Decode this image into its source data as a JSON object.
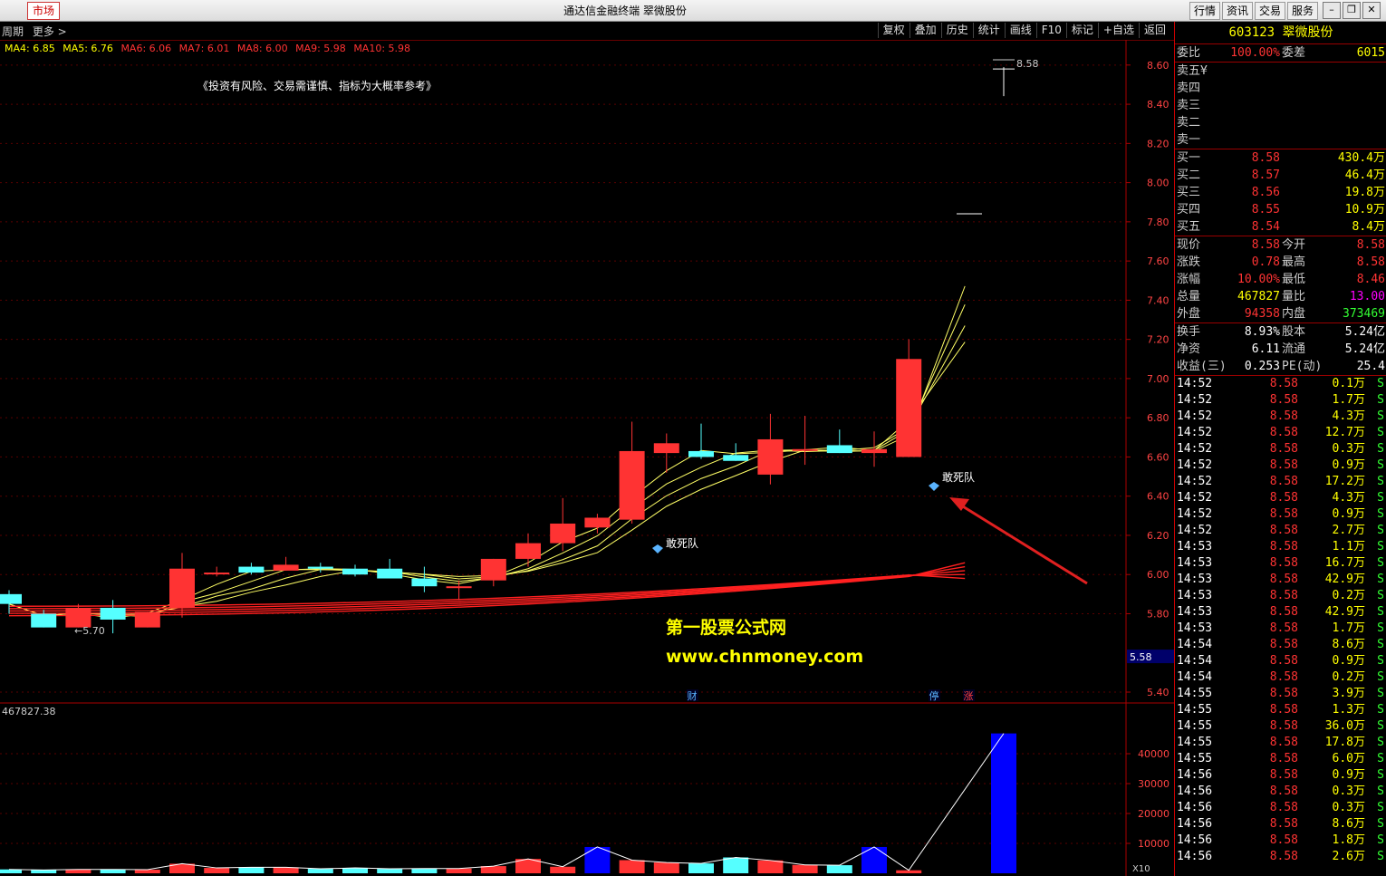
{
  "titlebar": {
    "market_tab": "市场",
    "title": "通达信金融终端  翠微股份",
    "menu": [
      "行情",
      "资讯",
      "交易",
      "服务"
    ]
  },
  "toolbar": {
    "left": [
      "周期",
      "更多 >"
    ],
    "right": [
      "复权",
      "叠加",
      "历史",
      "统计",
      "画线",
      "F10",
      "标记",
      "+自选",
      "返回"
    ]
  },
  "ma_legend": [
    {
      "label": "MA4: 6.85",
      "color": "#ffff00"
    },
    {
      "label": "MA5: 6.76",
      "color": "#ffff00"
    },
    {
      "label": "MA6: 6.06",
      "color": "#ff3333"
    },
    {
      "label": "MA7: 6.01",
      "color": "#ff3333"
    },
    {
      "label": "MA8: 6.00",
      "color": "#ff3333"
    },
    {
      "label": "MA9: 5.98",
      "color": "#ff3333"
    },
    {
      "label": "MA10: 5.98",
      "color": "#ff3333"
    }
  ],
  "warning_text": "《投资有风险、交易需谨慎、指标为大概率参考》",
  "chart_data": {
    "type": "candlestick",
    "ylim": [
      5.4,
      8.65
    ],
    "y_ticks": [
      "8.60",
      "8.40",
      "8.20",
      "8.00",
      "7.80",
      "7.60",
      "7.40",
      "7.20",
      "7.00",
      "6.80",
      "6.60",
      "6.40",
      "6.20",
      "6.00",
      "5.80",
      "5.40"
    ],
    "current_price_label": "5.58",
    "candles": [
      {
        "o": 5.9,
        "h": 5.92,
        "l": 5.8,
        "c": 5.85,
        "up": false
      },
      {
        "o": 5.8,
        "h": 5.82,
        "l": 5.73,
        "c": 5.73,
        "up": false
      },
      {
        "o": 5.73,
        "h": 5.85,
        "l": 5.73,
        "c": 5.83,
        "up": true
      },
      {
        "o": 5.83,
        "h": 5.87,
        "l": 5.7,
        "c": 5.77,
        "up": false
      },
      {
        "o": 5.73,
        "h": 5.81,
        "l": 5.73,
        "c": 5.81,
        "up": true
      },
      {
        "o": 5.83,
        "h": 6.11,
        "l": 5.78,
        "c": 6.03,
        "up": true
      },
      {
        "o": 6.01,
        "h": 6.04,
        "l": 5.99,
        "c": 6.01,
        "up": true
      },
      {
        "o": 6.04,
        "h": 6.06,
        "l": 6.0,
        "c": 6.01,
        "up": false
      },
      {
        "o": 6.02,
        "h": 6.09,
        "l": 6.02,
        "c": 6.05,
        "up": true
      },
      {
        "o": 6.04,
        "h": 6.06,
        "l": 6.01,
        "c": 6.03,
        "up": false
      },
      {
        "o": 6.03,
        "h": 6.05,
        "l": 5.99,
        "c": 6.0,
        "up": false
      },
      {
        "o": 6.03,
        "h": 6.08,
        "l": 5.99,
        "c": 5.98,
        "up": false
      },
      {
        "o": 5.98,
        "h": 6.04,
        "l": 5.91,
        "c": 5.94,
        "up": false
      },
      {
        "o": 5.94,
        "h": 5.97,
        "l": 5.87,
        "c": 5.94,
        "up": true
      },
      {
        "o": 5.97,
        "h": 6.08,
        "l": 5.94,
        "c": 6.08,
        "up": true
      },
      {
        "o": 6.08,
        "h": 6.21,
        "l": 6.04,
        "c": 6.16,
        "up": true
      },
      {
        "o": 6.16,
        "h": 6.39,
        "l": 6.12,
        "c": 6.26,
        "up": true
      },
      {
        "o": 6.24,
        "h": 6.31,
        "l": 6.21,
        "c": 6.29,
        "up": true
      },
      {
        "o": 6.28,
        "h": 6.78,
        "l": 6.26,
        "c": 6.63,
        "up": true
      },
      {
        "o": 6.62,
        "h": 6.72,
        "l": 6.52,
        "c": 6.67,
        "up": true
      },
      {
        "o": 6.63,
        "h": 6.77,
        "l": 6.59,
        "c": 6.6,
        "up": false
      },
      {
        "o": 6.61,
        "h": 6.67,
        "l": 6.58,
        "c": 6.58,
        "up": false
      },
      {
        "o": 6.51,
        "h": 6.82,
        "l": 6.46,
        "c": 6.69,
        "up": true
      },
      {
        "o": 6.64,
        "h": 6.81,
        "l": 6.56,
        "c": 6.64,
        "up": true
      },
      {
        "o": 6.66,
        "h": 6.74,
        "l": 6.62,
        "c": 6.62,
        "up": false
      },
      {
        "o": 6.62,
        "h": 6.73,
        "l": 6.55,
        "c": 6.64,
        "up": true
      },
      {
        "o": 6.6,
        "h": 7.2,
        "l": 6.6,
        "c": 7.1,
        "up": true
      },
      {
        "o": 8.58,
        "h": 8.58,
        "l": 8.58,
        "c": 8.58,
        "up": true
      }
    ],
    "labels": {
      "high_mark": "8.58",
      "low_mark": "5.70",
      "signal1": "敢死队",
      "signal2": "敢死队"
    },
    "bottom_markers": [
      "财",
      "停",
      "涨"
    ],
    "volume": {
      "title": "467827.38",
      "ylim": [
        0,
        50000
      ],
      "y_ticks": [
        "40000",
        "30000",
        "20000",
        "10000"
      ],
      "x10_label": "X10",
      "values": [
        1300,
        1100,
        1300,
        1300,
        1200,
        3200,
        1800,
        2000,
        2000,
        1500,
        1800,
        1500,
        1600,
        1600,
        2400,
        4800,
        2200,
        8800,
        4400,
        3600,
        3300,
        5300,
        4300,
        2800,
        2700,
        8800,
        1000,
        46782
      ],
      "blue": [
        17,
        25,
        27
      ]
    }
  },
  "quote_panel": {
    "code_name": "603123 翠微股份",
    "weibi": {
      "l": "委比",
      "v": "100.00%",
      "l2": "委差",
      "v2": "6015"
    },
    "sells": [
      {
        "l": "卖五",
        "p": "¥"
      },
      {
        "l": "卖四",
        "p": ""
      },
      {
        "l": "卖三",
        "p": ""
      },
      {
        "l": "卖二",
        "p": ""
      },
      {
        "l": "卖一",
        "p": ""
      }
    ],
    "buys": [
      {
        "l": "买一",
        "p": "8.58",
        "v": "430.4万"
      },
      {
        "l": "买二",
        "p": "8.57",
        "v": "46.4万"
      },
      {
        "l": "买三",
        "p": "8.56",
        "v": "19.8万"
      },
      {
        "l": "买四",
        "p": "8.55",
        "v": "10.9万"
      },
      {
        "l": "买五",
        "p": "8.54",
        "v": "8.4万"
      }
    ],
    "stats": [
      {
        "a": "现价",
        "b": "8.58",
        "bc": "red",
        "c": "今开",
        "d": "8.58",
        "dc": "red"
      },
      {
        "a": "涨跌",
        "b": "0.78",
        "bc": "red",
        "c": "最高",
        "d": "8.58",
        "dc": "red"
      },
      {
        "a": "涨幅",
        "b": "10.00%",
        "bc": "red",
        "c": "最低",
        "d": "8.46",
        "dc": "red"
      },
      {
        "a": "总量",
        "b": "467827",
        "bc": "yel",
        "c": "量比",
        "d": "13.00",
        "dc": "mag"
      },
      {
        "a": "外盘",
        "b": "94358",
        "bc": "red",
        "c": "内盘",
        "d": "373469",
        "dc": "grn"
      }
    ],
    "stats2": [
      {
        "a": "换手",
        "b": "8.93%",
        "bc": "wht",
        "c": "股本",
        "d": "5.24亿",
        "dc": "wht"
      },
      {
        "a": "净资",
        "b": "6.11",
        "bc": "wht",
        "c": "流通",
        "d": "5.24亿",
        "dc": "wht"
      },
      {
        "a": "收益(三)",
        "b": "0.253",
        "bc": "wht",
        "c": "PE(动)",
        "d": "25.4",
        "dc": "wht"
      }
    ],
    "ticks": [
      [
        "14:52",
        "8.58",
        "0.1万",
        "S",
        "yel"
      ],
      [
        "14:52",
        "8.58",
        "1.7万",
        "S",
        "yel"
      ],
      [
        "14:52",
        "8.58",
        "4.3万",
        "S",
        "yel"
      ],
      [
        "14:52",
        "8.58",
        "12.7万",
        "S",
        "yel"
      ],
      [
        "14:52",
        "8.58",
        "0.3万",
        "S",
        "yel"
      ],
      [
        "14:52",
        "8.58",
        "0.9万",
        "S",
        "yel"
      ],
      [
        "14:52",
        "8.58",
        "17.2万",
        "S",
        "yel"
      ],
      [
        "14:52",
        "8.58",
        "4.3万",
        "S",
        "yel"
      ],
      [
        "14:52",
        "8.58",
        "0.9万",
        "S",
        "yel"
      ],
      [
        "14:52",
        "8.58",
        "2.7万",
        "S",
        "yel"
      ],
      [
        "14:53",
        "8.58",
        "1.1万",
        "S",
        "yel"
      ],
      [
        "14:53",
        "8.58",
        "16.7万",
        "S",
        "yel"
      ],
      [
        "14:53",
        "8.58",
        "42.9万",
        "S",
        "mag"
      ],
      [
        "14:53",
        "8.58",
        "0.2万",
        "S",
        "yel"
      ],
      [
        "14:53",
        "8.58",
        "42.9万",
        "S",
        "mag"
      ],
      [
        "14:53",
        "8.58",
        "1.7万",
        "S",
        "yel"
      ],
      [
        "14:54",
        "8.58",
        "8.6万",
        "S",
        "yel"
      ],
      [
        "14:54",
        "8.58",
        "0.9万",
        "S",
        "yel"
      ],
      [
        "14:54",
        "8.58",
        "0.2万",
        "S",
        "yel"
      ],
      [
        "14:55",
        "8.58",
        "3.9万",
        "S",
        "yel"
      ],
      [
        "14:55",
        "8.58",
        "1.3万",
        "S",
        "yel"
      ],
      [
        "14:55",
        "8.58",
        "36.0万",
        "S",
        "yel"
      ],
      [
        "14:55",
        "8.58",
        "17.8万",
        "S",
        "yel"
      ],
      [
        "14:55",
        "8.58",
        "6.0万",
        "S",
        "yel"
      ],
      [
        "14:56",
        "8.58",
        "0.9万",
        "S",
        "yel"
      ],
      [
        "14:56",
        "8.58",
        "0.3万",
        "S",
        "yel"
      ],
      [
        "14:56",
        "8.58",
        "0.3万",
        "S",
        "yel"
      ],
      [
        "14:56",
        "8.58",
        "8.6万",
        "S",
        "yel"
      ],
      [
        "14:56",
        "8.58",
        "1.8万",
        "S",
        "yel"
      ],
      [
        "14:56",
        "8.58",
        "2.6万",
        "S",
        "yel"
      ]
    ]
  },
  "watermark": {
    "line1": "第一股票公式网",
    "line2": "www.chnmoney.com"
  }
}
